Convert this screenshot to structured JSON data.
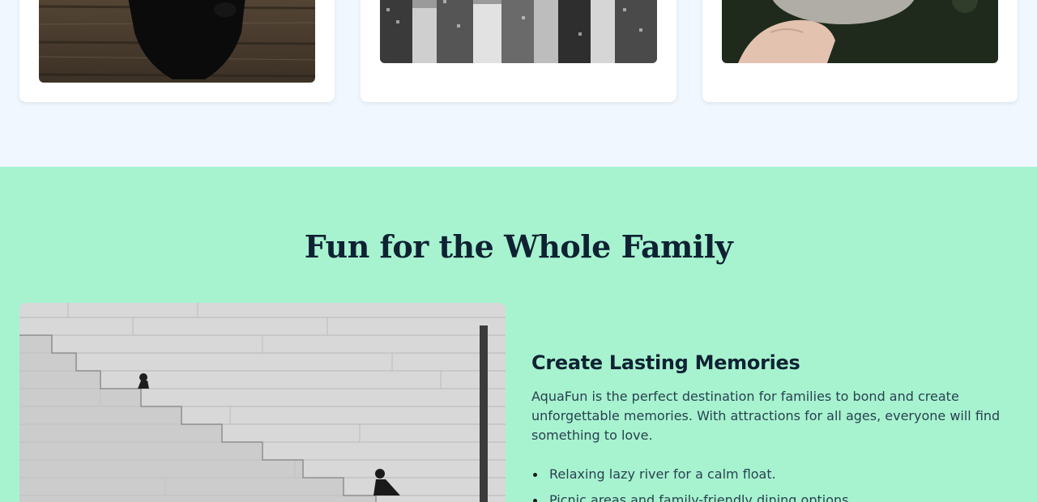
{
  "gallery": {
    "cards": [
      {
        "image_alt": "black dog on wooden floor"
      },
      {
        "image_alt": "black and white city skyline"
      },
      {
        "image_alt": "hand holding a small animal"
      }
    ]
  },
  "family": {
    "title": "Fun for the Whole Family",
    "image_alt": "people sitting on stone staircase",
    "heading": "Create Lasting Memories",
    "description": "AquaFun is the perfect destination for families to bond and create unforgettable memories. With attractions for all ages, everyone will find something to love.",
    "features": [
      "Relaxing lazy river for a calm float.",
      "Picnic areas and family-friendly dining options."
    ]
  },
  "colors": {
    "gallery_bg": "#f0f7ff",
    "family_bg": "#a7f3d0",
    "heading": "#0f2233",
    "body_text": "#2a4150"
  }
}
